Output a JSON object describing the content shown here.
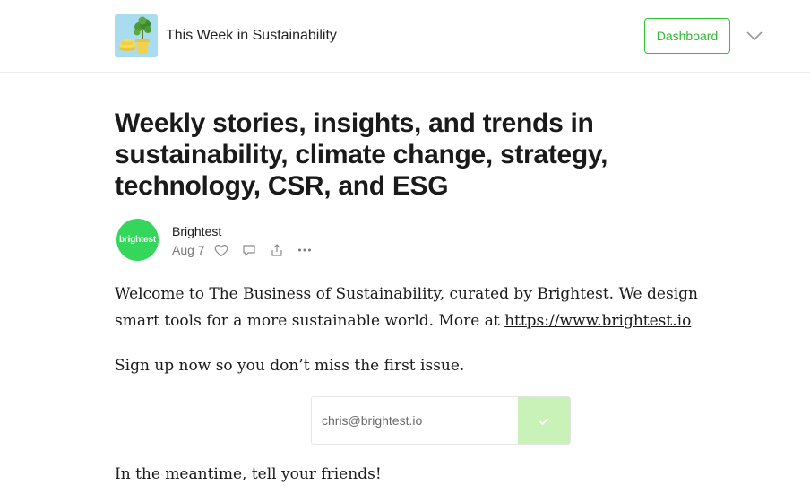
{
  "header": {
    "publication_name": "This Week in Sustainability",
    "dashboard_label": "Dashboard"
  },
  "post": {
    "title": "Weekly stories, insights, and trends in sustainability, climate change, strategy, technology, CSR, and ESG",
    "author": {
      "avatar_text": "brightest",
      "name": "Brightest",
      "avatar_color": "#35d65c"
    },
    "date": "Aug 7",
    "actions": [
      "heart-icon",
      "comment-icon",
      "share-icon",
      "more-icon"
    ]
  },
  "body": {
    "p1_text": "Welcome to The Business of Sustainability, curated by Brightest. We design smart tools for a more sustainable world. More at ",
    "p1_link": "https://www.brightest.io",
    "p2_text": "Sign up now so you don’t miss the first issue.",
    "p3_prefix": "In the meantime, ",
    "p3_link": "tell your friends",
    "p3_suffix": "!"
  },
  "subscribe": {
    "email_value": "chris@brightest.io",
    "button_icon": "check-icon"
  },
  "colors": {
    "accent": "#2fc42f",
    "subscribe_button": "#c8f2b8"
  }
}
